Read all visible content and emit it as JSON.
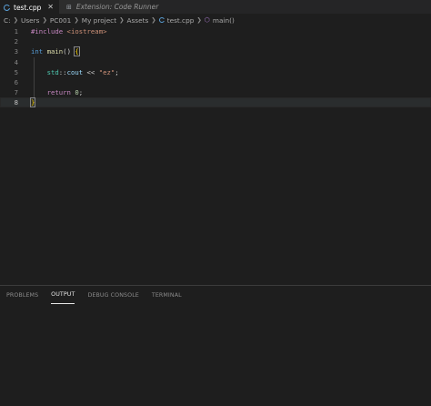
{
  "tabs": [
    {
      "label": "test.cpp",
      "icon": "cpp-file-icon",
      "active": true
    },
    {
      "label": "Extension: Code Runner",
      "icon": "extension-icon",
      "active": false
    }
  ],
  "breadcrumb": {
    "items": [
      "C:",
      "Users",
      "PC001",
      "My project",
      "Assets",
      "test.cpp",
      "main()"
    ]
  },
  "editor": {
    "language": "cpp",
    "current_line": 8,
    "lines": [
      {
        "number": "1",
        "tokens": [
          {
            "t": "#include ",
            "c": "kw-pre"
          },
          {
            "t": "<iostream>",
            "c": "inc"
          }
        ]
      },
      {
        "number": "2",
        "tokens": []
      },
      {
        "number": "3",
        "tokens": [
          {
            "t": "int",
            "c": "kw-type"
          },
          {
            "t": " ",
            "c": "op"
          },
          {
            "t": "main",
            "c": "fn"
          },
          {
            "t": "() ",
            "c": "op"
          },
          {
            "t": "{",
            "c": "brace-y"
          }
        ]
      },
      {
        "number": "4",
        "tokens": []
      },
      {
        "number": "5",
        "tokens": [
          {
            "t": "    ",
            "c": "op"
          },
          {
            "t": "std",
            "c": "ns"
          },
          {
            "t": "::",
            "c": "op"
          },
          {
            "t": "cout",
            "c": "var"
          },
          {
            "t": " << ",
            "c": "op"
          },
          {
            "t": "\"ez\"",
            "c": "str"
          },
          {
            "t": ";",
            "c": "op"
          }
        ]
      },
      {
        "number": "6",
        "tokens": []
      },
      {
        "number": "7",
        "tokens": [
          {
            "t": "    ",
            "c": "op"
          },
          {
            "t": "return",
            "c": "kw-ctrl"
          },
          {
            "t": " ",
            "c": "op"
          },
          {
            "t": "0",
            "c": "num"
          },
          {
            "t": ";",
            "c": "op"
          }
        ]
      },
      {
        "number": "8",
        "tokens": [
          {
            "t": "}",
            "c": "brace-y"
          }
        ]
      }
    ]
  },
  "panel": {
    "tabs": [
      {
        "label": "PROBLEMS",
        "active": false
      },
      {
        "label": "OUTPUT",
        "active": true
      },
      {
        "label": "DEBUG CONSOLE",
        "active": false
      },
      {
        "label": "TERMINAL",
        "active": false
      }
    ]
  },
  "colors": {
    "background": "#1e1e1e",
    "tabbar": "#252526",
    "keyword": "#569cd6",
    "string": "#ce9178",
    "function": "#dcdcaa",
    "bracket": "#ffd700"
  }
}
